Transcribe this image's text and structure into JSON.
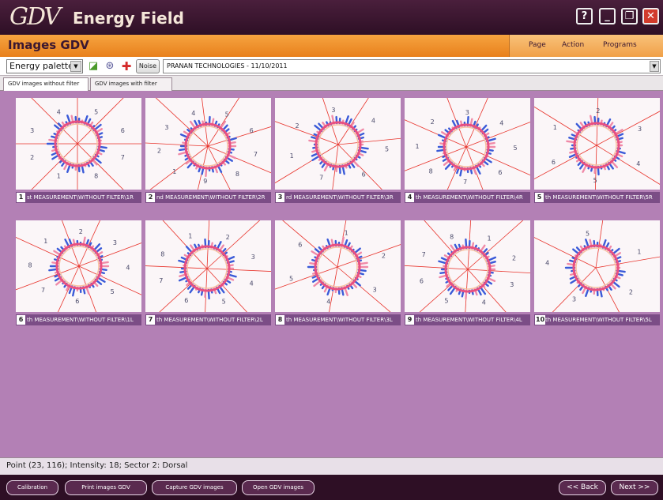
{
  "window": {
    "logo": "GDV",
    "title": "Energy Field",
    "help_label": "?",
    "minimize_label": "_",
    "maximize_label": "❐",
    "close_label": "✕"
  },
  "header": {
    "title": "Images GDV",
    "menu": [
      "Page",
      "Action",
      "Programs"
    ]
  },
  "toolbar": {
    "palette_value": "Energy palette",
    "noise_label": "Noise",
    "session_value": "PRANAN TECHNOLOGIES - 11/10/2011",
    "icons": [
      "palette-icon",
      "target-icon",
      "crosshair-icon"
    ]
  },
  "tabs": [
    "GDV images without filter",
    "GDV images with filter"
  ],
  "images": [
    {
      "num": "1",
      "caption": "st MEASUREMENT\\WITHOUT FILTER\\1R",
      "sectors": [
        "1",
        "2",
        "3",
        "4",
        "5",
        "6",
        "7",
        "8"
      ]
    },
    {
      "num": "2",
      "caption": "nd MEASUREMENT\\WITHOUT FILTER\\2R",
      "sectors": [
        "1",
        "2",
        "3",
        "4",
        "5",
        "6",
        "7",
        "8",
        "9"
      ]
    },
    {
      "num": "3",
      "caption": "rd MEASUREMENT\\WITHOUT FILTER\\3R",
      "sectors": [
        "1",
        "2",
        "3",
        "4",
        "5",
        "6",
        "7"
      ]
    },
    {
      "num": "4",
      "caption": "th MEASUREMENT\\WITHOUT FILTER\\4R",
      "sectors": [
        "1",
        "2",
        "3",
        "4",
        "5",
        "6",
        "7",
        "8"
      ]
    },
    {
      "num": "5",
      "caption": "th MEASUREMENT\\WITHOUT FILTER\\5R",
      "sectors": [
        "1",
        "2",
        "3",
        "4",
        "5",
        "6"
      ]
    },
    {
      "num": "6",
      "caption": "th MEASUREMENT\\WITHOUT FILTER\\1L",
      "sectors": [
        "1",
        "2",
        "3",
        "4",
        "5",
        "6",
        "7",
        "8"
      ]
    },
    {
      "num": "7",
      "caption": "th MEASUREMENT\\WITHOUT FILTER\\2L",
      "sectors": [
        "1",
        "2",
        "3",
        "4",
        "5",
        "6",
        "7",
        "8"
      ]
    },
    {
      "num": "8",
      "caption": "th MEASUREMENT\\WITHOUT FILTER\\3L",
      "sectors": [
        "1",
        "2",
        "3",
        "4",
        "5",
        "6"
      ]
    },
    {
      "num": "9",
      "caption": "th MEASUREMENT\\WITHOUT FILTER\\4L",
      "sectors": [
        "1",
        "2",
        "3",
        "4",
        "5",
        "6",
        "7",
        "8"
      ]
    },
    {
      "num": "10",
      "caption": "th MEASUREMENT\\WITHOUT FILTER\\5L",
      "sectors": [
        "1",
        "2",
        "3",
        "4",
        "5"
      ]
    }
  ],
  "status": "Point (23, 116); Intensity: 18; Sector 2: Dorsal",
  "bottom": {
    "calibration": "Calibration",
    "print": "Print images GDV",
    "capture": "Capture GDV images",
    "open": "Open GDV images",
    "back": "<< Back",
    "next": "Next >>"
  },
  "colors": {
    "titlebar": "#2e0f25",
    "header_orange": "#f0912c",
    "main_bg": "#b380b5",
    "caption_bg": "#7b4d86",
    "sector_line": "#e8322a",
    "glow_blue": "#3a5ad8"
  }
}
